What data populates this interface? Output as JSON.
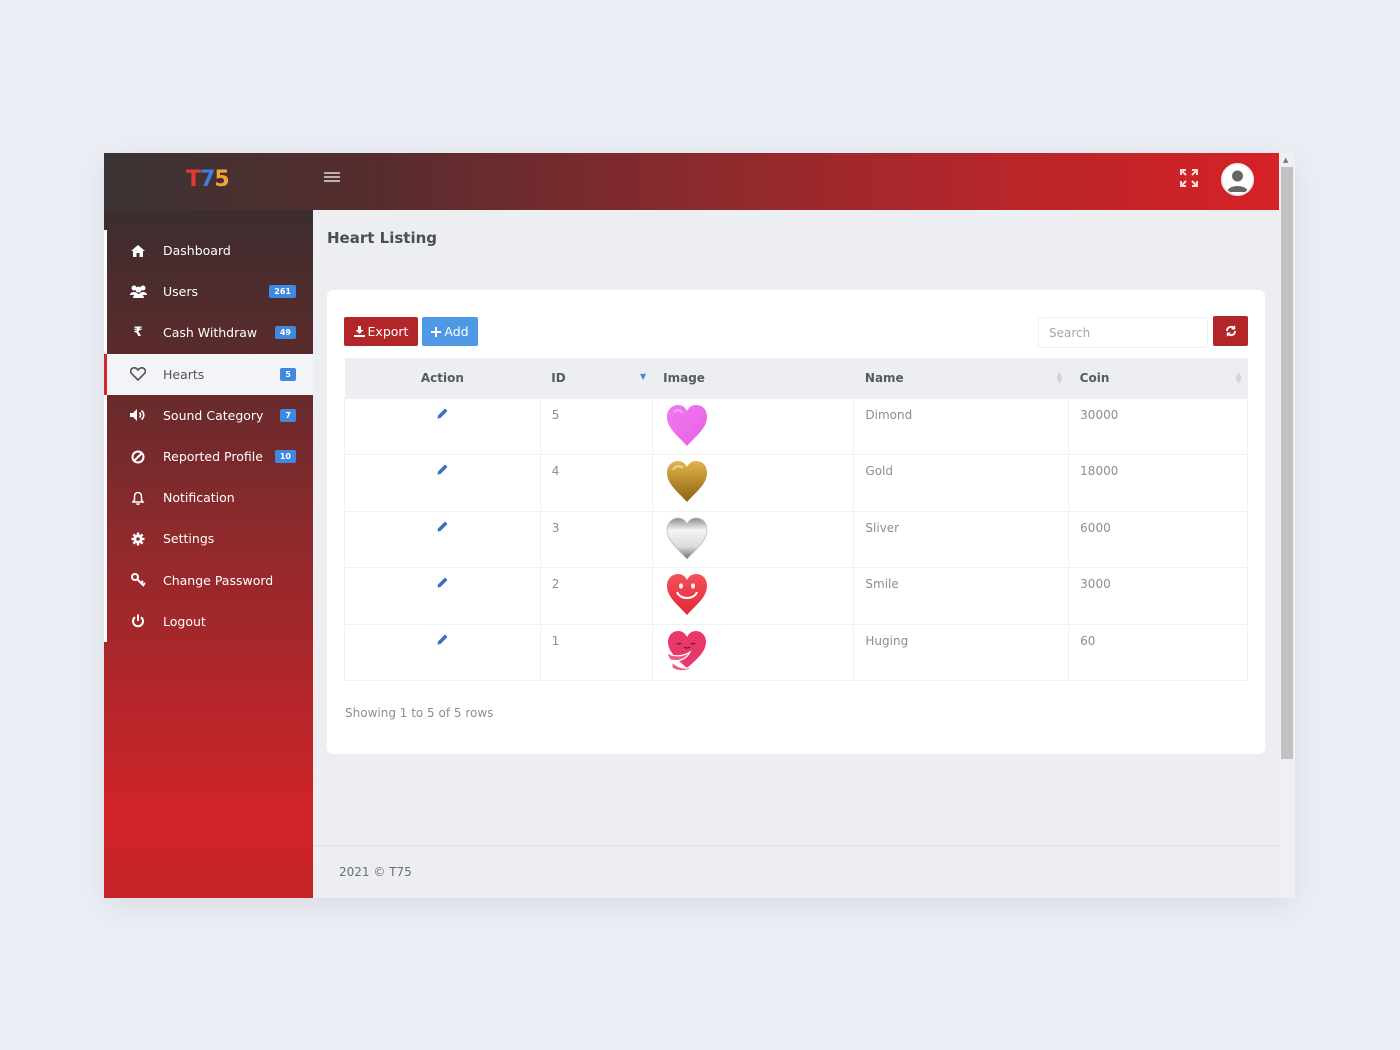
{
  "app": {
    "logo_parts": [
      "T",
      "7",
      "5"
    ],
    "brand_color": "#d62226",
    "accent_blue": "#3f8ae0"
  },
  "topbar": {
    "menu_icon": "hamburger-icon",
    "fullscreen_icon": "expand-icon",
    "avatar_icon": "user-avatar-icon"
  },
  "sidebar": {
    "items": [
      {
        "label": "Dashboard",
        "icon": "home-icon",
        "badge": null,
        "active": false
      },
      {
        "label": "Users",
        "icon": "users-icon",
        "badge": "261",
        "active": false
      },
      {
        "label": "Cash Withdraw",
        "icon": "rupee-icon",
        "badge": "49",
        "active": false
      },
      {
        "label": "Hearts",
        "icon": "heart-icon",
        "badge": "5",
        "active": true
      },
      {
        "label": "Sound Category",
        "icon": "volume-icon",
        "badge": "7",
        "active": false
      },
      {
        "label": "Reported Profile",
        "icon": "ban-icon",
        "badge": "10",
        "active": false
      },
      {
        "label": "Notification",
        "icon": "bell-icon",
        "badge": null,
        "active": false
      },
      {
        "label": "Settings",
        "icon": "gear-icon",
        "badge": null,
        "active": false
      },
      {
        "label": "Change Password",
        "icon": "key-icon",
        "badge": null,
        "active": false
      },
      {
        "label": "Logout",
        "icon": "power-icon",
        "badge": null,
        "active": false
      }
    ]
  },
  "main": {
    "page_title": "Heart Listing",
    "toolbar": {
      "export_label": "Export",
      "add_label": "Add",
      "search_placeholder": "Search",
      "search_value": "",
      "refresh_icon": "refresh-icon"
    },
    "table": {
      "columns": [
        "Action",
        "ID",
        "Image",
        "Name",
        "Coin"
      ],
      "sorted_column": "ID",
      "sort_direction": "desc",
      "rows": [
        {
          "id": "5",
          "image": "pink-heart",
          "name": "Dimond",
          "coin": "30000"
        },
        {
          "id": "4",
          "image": "gold-heart",
          "name": "Gold",
          "coin": "18000"
        },
        {
          "id": "3",
          "image": "silver-heart",
          "name": "Sliver",
          "coin": "6000"
        },
        {
          "id": "2",
          "image": "smile-heart",
          "name": "Smile",
          "coin": "3000"
        },
        {
          "id": "1",
          "image": "hugging-heart",
          "name": "Huging",
          "coin": "60"
        }
      ]
    },
    "pagination_info": "Showing 1 to 5 of 5 rows"
  },
  "footer": {
    "text": "2021 © T75"
  }
}
